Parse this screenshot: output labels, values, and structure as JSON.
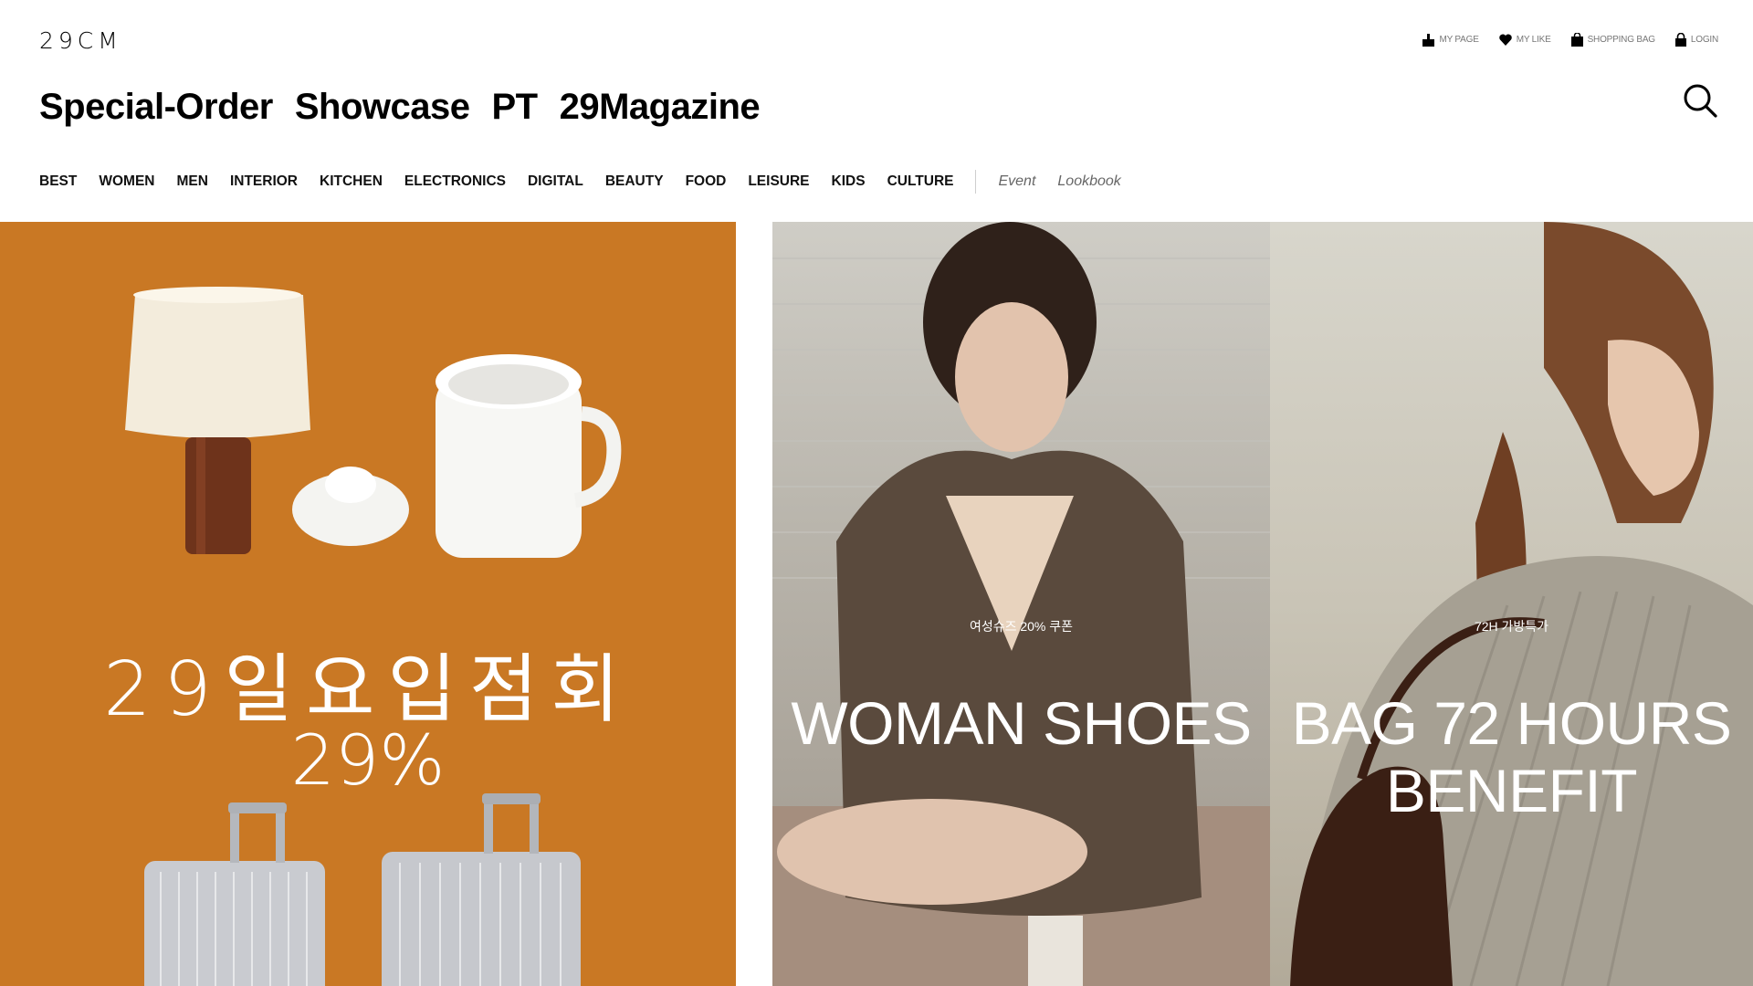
{
  "brand": {
    "logo": "29CM"
  },
  "util_nav": [
    {
      "label": "MY PAGE",
      "icon": "user-icon"
    },
    {
      "label": "MY LIKE",
      "icon": "heart-icon"
    },
    {
      "label": "SHOPPING BAG",
      "icon": "bag-icon"
    },
    {
      "label": "LOGIN",
      "icon": "lock-icon"
    }
  ],
  "main_nav": [
    "Special-Order",
    "Showcase",
    "PT",
    "29Magazine"
  ],
  "categories": [
    "BEST",
    "WOMEN",
    "MEN",
    "INTERIOR",
    "KITCHEN",
    "ELECTRONICS",
    "DIGITAL",
    "BEAUTY",
    "FOOD",
    "LEISURE",
    "KIDS",
    "CULTURE"
  ],
  "sub_links": [
    "Event",
    "Lookbook"
  ],
  "banners": {
    "left": {
      "title": "29일요입점회",
      "percent": "29%",
      "bg": "#c97824"
    },
    "middle": {
      "subtitle": "여성슈즈 20% 쿠폰",
      "title": "WOMAN SHOES"
    },
    "right": {
      "subtitle": "72H 가방특가",
      "title_line1": "BAG 72 HOURS",
      "title_line2": "BENEFIT"
    }
  }
}
